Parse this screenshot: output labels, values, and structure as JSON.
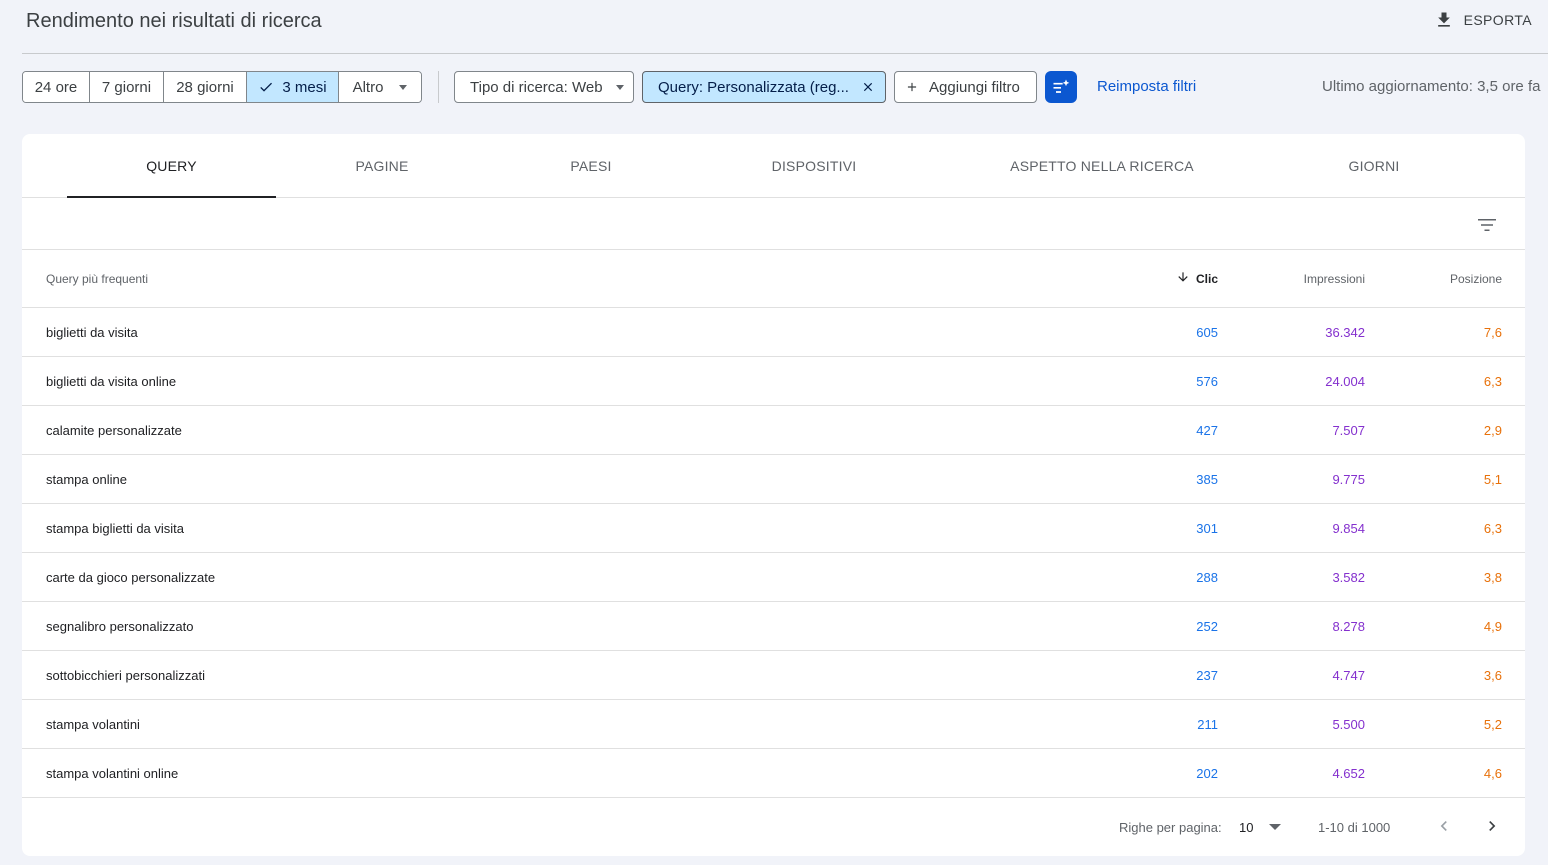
{
  "header": {
    "title": "Rendimento nei risultati di ricerca",
    "export_label": "ESPORTA"
  },
  "date_range": {
    "options": [
      "24 ore",
      "7 giorni",
      "28 giorni",
      "3 mesi",
      "Altro"
    ],
    "selected": "3 mesi"
  },
  "filters": {
    "search_type": "Tipo di ricerca: Web",
    "query_filter": "Query: Personalizzata (reg...",
    "add_filter": "Aggiungi filtro",
    "reset": "Reimposta filtri",
    "last_update": "Ultimo aggiornamento: 3,5 ore fa"
  },
  "tabs": [
    "QUERY",
    "PAGINE",
    "PAESI",
    "DISPOSITIVI",
    "ASPETTO NELLA RICERCA",
    "GIORNI"
  ],
  "active_tab": "QUERY",
  "table": {
    "columns": {
      "query": "Query più frequenti",
      "clicks": "Clic",
      "impressions": "Impressioni",
      "position": "Posizione"
    },
    "rows": [
      {
        "query": "biglietti da visita",
        "clicks": "605",
        "impressions": "36.342",
        "position": "7,6"
      },
      {
        "query": "biglietti da visita online",
        "clicks": "576",
        "impressions": "24.004",
        "position": "6,3"
      },
      {
        "query": "calamite personalizzate",
        "clicks": "427",
        "impressions": "7.507",
        "position": "2,9"
      },
      {
        "query": "stampa online",
        "clicks": "385",
        "impressions": "9.775",
        "position": "5,1"
      },
      {
        "query": "stampa biglietti da visita",
        "clicks": "301",
        "impressions": "9.854",
        "position": "6,3"
      },
      {
        "query": "carte da gioco personalizzate",
        "clicks": "288",
        "impressions": "3.582",
        "position": "3,8"
      },
      {
        "query": "segnalibro personalizzato",
        "clicks": "252",
        "impressions": "8.278",
        "position": "4,9"
      },
      {
        "query": "sottobicchieri personalizzati",
        "clicks": "237",
        "impressions": "4.747",
        "position": "3,6"
      },
      {
        "query": "stampa volantini",
        "clicks": "211",
        "impressions": "5.500",
        "position": "5,2"
      },
      {
        "query": "stampa volantini online",
        "clicks": "202",
        "impressions": "4.652",
        "position": "4,6"
      }
    ]
  },
  "pagination": {
    "rows_per_page_label": "Righe per pagina:",
    "rows_per_page": "10",
    "range": "1-10 di 1000"
  },
  "colors": {
    "clicks": "#1a73e8",
    "impressions": "#8430ce",
    "position": "#e8710a",
    "accent": "#0b57d0",
    "selected_chip": "#c2e7ff"
  }
}
